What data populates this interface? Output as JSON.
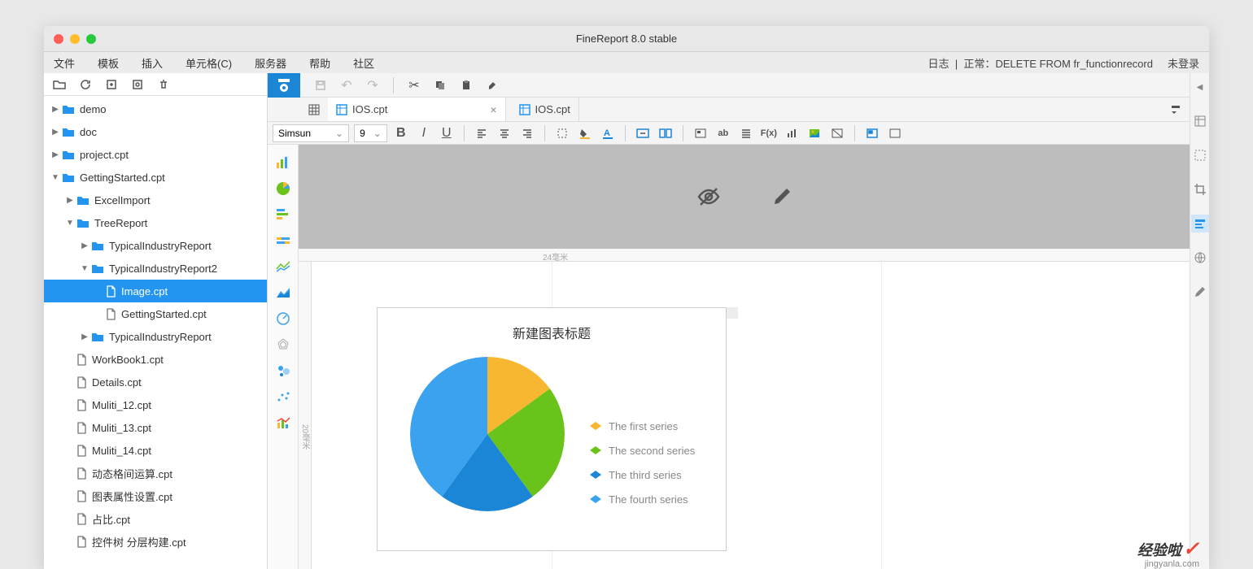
{
  "window": {
    "title": "FineReport 8.0 stable"
  },
  "menubar": {
    "items": [
      "文件",
      "模板",
      "插入",
      "单元格(C)",
      "服务器",
      "帮助",
      "社区"
    ],
    "log_label": "日志",
    "status": "正常：DELETE FROM fr_functionrecord",
    "login": "未登录"
  },
  "tree": {
    "items": [
      {
        "depth": 0,
        "type": "folder",
        "label": "demo",
        "arrow": "right"
      },
      {
        "depth": 0,
        "type": "folder",
        "label": "doc",
        "arrow": "right"
      },
      {
        "depth": 0,
        "type": "folder",
        "label": "project.cpt",
        "arrow": "right"
      },
      {
        "depth": 0,
        "type": "folder",
        "label": "GettingStarted.cpt",
        "arrow": "down"
      },
      {
        "depth": 1,
        "type": "folder",
        "label": "ExcelImport",
        "arrow": "right"
      },
      {
        "depth": 1,
        "type": "folder",
        "label": "TreeReport",
        "arrow": "down"
      },
      {
        "depth": 2,
        "type": "folder",
        "label": "TypicalIndustryReport",
        "arrow": "right"
      },
      {
        "depth": 2,
        "type": "folder",
        "label": "TypicalIndustryReport2",
        "arrow": "down"
      },
      {
        "depth": 3,
        "type": "file",
        "label": "Image.cpt",
        "selected": true
      },
      {
        "depth": 3,
        "type": "file",
        "label": "GettingStarted.cpt"
      },
      {
        "depth": 2,
        "type": "folder",
        "label": "TypicalIndustryReport",
        "arrow": "right"
      },
      {
        "depth": 1,
        "type": "file",
        "label": "WorkBook1.cpt"
      },
      {
        "depth": 1,
        "type": "file",
        "label": "Details.cpt"
      },
      {
        "depth": 1,
        "type": "file",
        "label": "Muliti_12.cpt"
      },
      {
        "depth": 1,
        "type": "file",
        "label": "Muliti_13.cpt"
      },
      {
        "depth": 1,
        "type": "file",
        "label": "Muliti_14.cpt"
      },
      {
        "depth": 1,
        "type": "file",
        "label": "动态格间运算.cpt"
      },
      {
        "depth": 1,
        "type": "file",
        "label": "图表属性设置.cpt"
      },
      {
        "depth": 1,
        "type": "file",
        "label": "占比.cpt"
      },
      {
        "depth": 1,
        "type": "file",
        "label": "控件树 分层构建.cpt"
      }
    ]
  },
  "tabs": {
    "active": {
      "label": "IOS.cpt"
    },
    "inactive": {
      "label": "IOS.cpt"
    }
  },
  "font": {
    "name": "Simsun",
    "size": "9"
  },
  "ruler": {
    "h": "24毫米",
    "v": "20毫米"
  },
  "chart_data": {
    "type": "pie",
    "title": "新建图表标题",
    "series": [
      {
        "name": "The first series",
        "value": 15,
        "color": "#f7b731"
      },
      {
        "name": "The second series",
        "value": 25,
        "color": "#6ac31a"
      },
      {
        "name": "The third series",
        "value": 20,
        "color": "#1b85d6"
      },
      {
        "name": "The fourth series",
        "value": 40,
        "color": "#3aa2ef"
      }
    ]
  },
  "watermark": {
    "brand": "经验啦",
    "url": "jingyanla.com"
  }
}
